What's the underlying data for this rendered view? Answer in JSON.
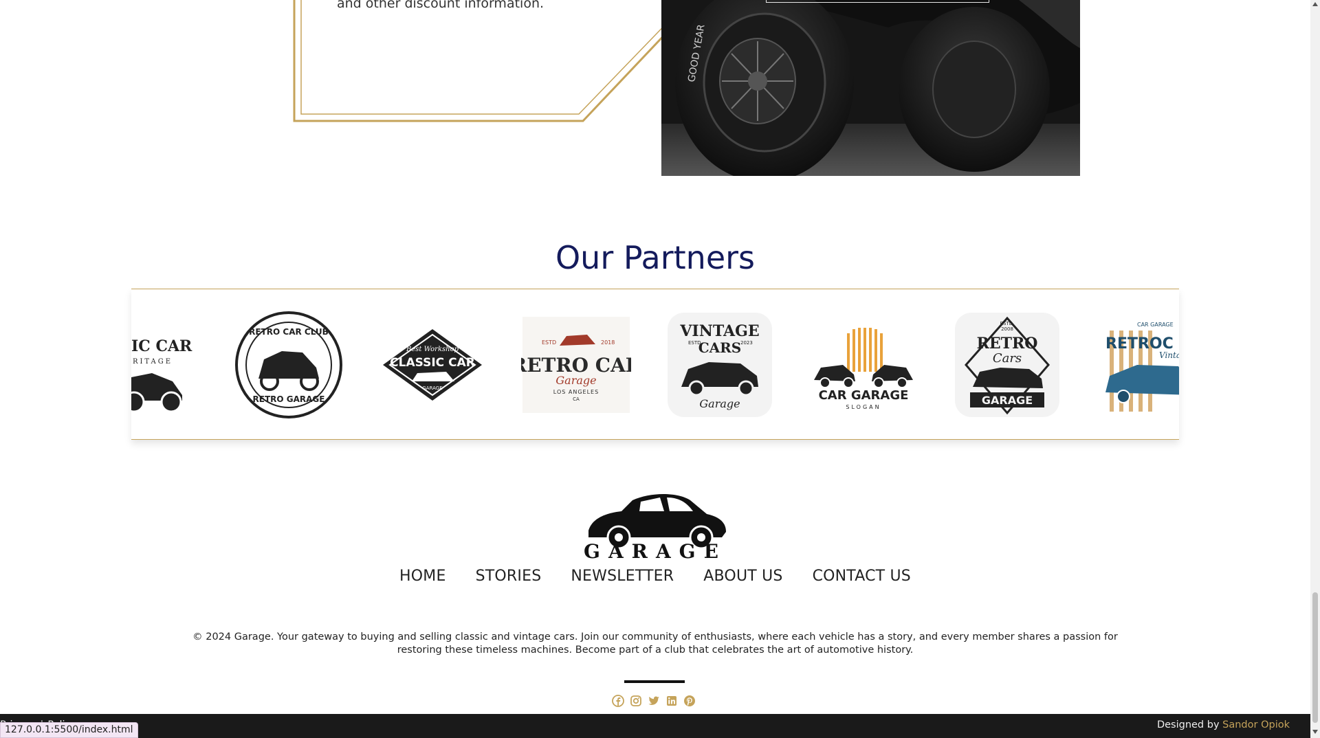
{
  "promo": {
    "text": "and other discount information."
  },
  "partners": {
    "title": "Our Partners",
    "logos": [
      {
        "lines": [
          "ASSIC CAR",
          "HERITAGE"
        ]
      },
      {
        "lines": [
          "RETRO CAR CLUB",
          "RETRO GARAGE"
        ]
      },
      {
        "lines": [
          "Best Workshop",
          "CLASSIC CAR",
          "GARAGE"
        ]
      },
      {
        "lines": [
          "ESTD",
          "2018",
          "RETRO CAR",
          "Garage",
          "LOS ANGELES",
          "CA"
        ]
      },
      {
        "lines": [
          "VINTAGE",
          "CARS",
          "ESTD",
          "2023",
          "Garage"
        ]
      },
      {
        "lines": [
          "CAR GARAGE",
          "SLOGAN"
        ]
      },
      {
        "lines": [
          "ESTD.",
          "2008",
          "RETRO",
          "Cars",
          "GARAGE"
        ]
      },
      {
        "lines": [
          "CAR GARAGE",
          "RETROC",
          "Vintage"
        ]
      }
    ]
  },
  "footer": {
    "logo_text": "GARAGE",
    "nav": [
      "HOME",
      "STORIES",
      "NEWSLETTER",
      "ABOUT US",
      "CONTACT US"
    ],
    "copyright": "© 2024 Garage. Your gateway to buying and selling classic and vintage cars. Join our community of enthusiasts, where each vehicle has a story, and every member shares a passion for restoring these timeless machines. Become part of a club that celebrates the art of automotive history.",
    "social": [
      "facebook-icon",
      "instagram-icon",
      "twitter-icon",
      "linkedin-icon",
      "pinterest-icon"
    ],
    "legal": [
      "Privacy",
      "|",
      "Policy"
    ],
    "designed_prefix": "Designed by",
    "designed_author": "Sandor Opiok"
  },
  "browser": {
    "status_url": "127.0.0.1:5500/index.html"
  },
  "hero": {
    "tire_text": "GOOD YEAR"
  },
  "colors": {
    "gold": "#c5a35a",
    "navy": "#141b5c",
    "dark": "#1a1a1a"
  }
}
